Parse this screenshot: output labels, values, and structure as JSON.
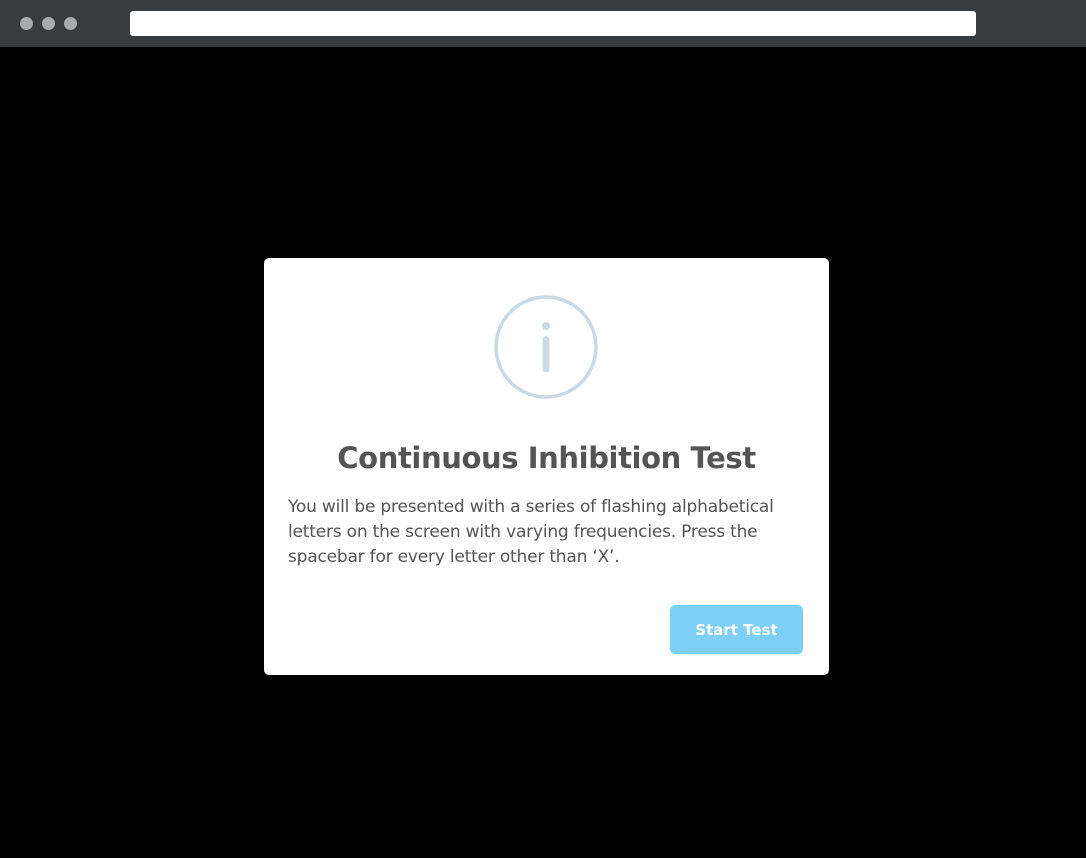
{
  "browser": {
    "address_value": "",
    "chrome_color": "#3a3b3d"
  },
  "modal": {
    "icon": "info-icon",
    "icon_color": "#c9dae5",
    "title": "Continuous Inhibition Test",
    "description": "You will be presented with a series of flashing alphabetical letters on the screen with varying frequencies. Press the spacebar for every letter other than ‘X’.",
    "start_button_label": "Start Test",
    "button_color": "#7dcff6"
  },
  "page": {
    "background": "#000000"
  }
}
